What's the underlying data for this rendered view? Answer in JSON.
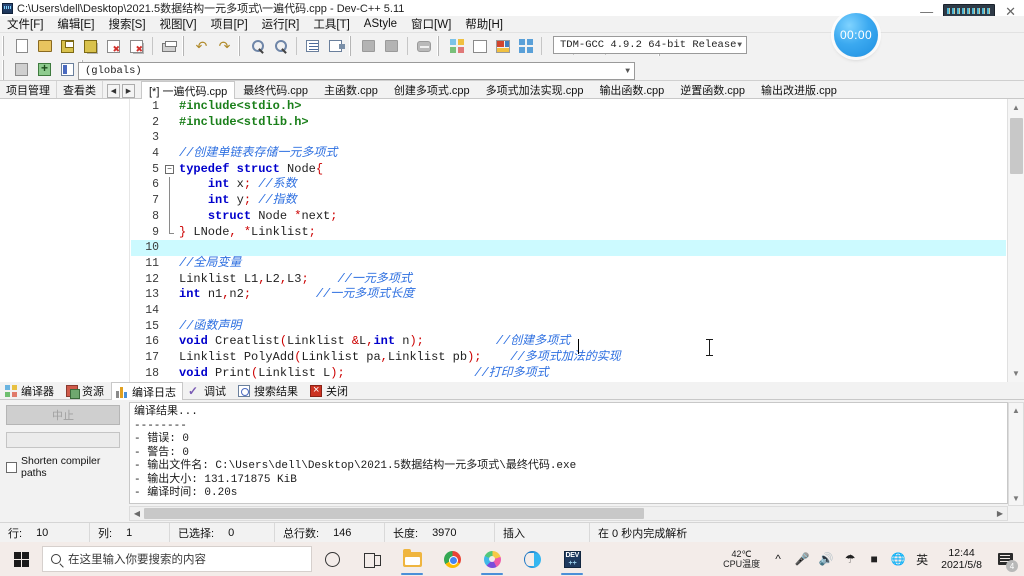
{
  "window": {
    "title": "C:\\Users\\dell\\Desktop\\2021.5数据结构一元多项式\\一遍代码.cpp - Dev-C++ 5.11",
    "minimize_label": "—",
    "close_label": "✕"
  },
  "timer": {
    "value": "00:00"
  },
  "menu": {
    "items": [
      {
        "label": "文件[F]"
      },
      {
        "label": "编辑[E]"
      },
      {
        "label": "搜索[S]"
      },
      {
        "label": "视图[V]"
      },
      {
        "label": "项目[P]"
      },
      {
        "label": "运行[R]"
      },
      {
        "label": "工具[T]"
      },
      {
        "label": "AStyle"
      },
      {
        "label": "窗口[W]"
      },
      {
        "label": "帮助[H]"
      }
    ]
  },
  "toolbar": {
    "compiler_combo": {
      "value": "TDM-GCC 4.9.2 64-bit Release",
      "arrow": "▼"
    },
    "globals_combo": {
      "value": "(globals)",
      "arrow": "▼"
    },
    "buttons": [
      {
        "name": "new-file",
        "icon": "page-icon"
      },
      {
        "name": "open-file",
        "icon": "folder-open-icon"
      },
      {
        "name": "save-file",
        "icon": "save-icon"
      },
      {
        "name": "save-all",
        "icon": "save-all-icon"
      },
      {
        "name": "close-file",
        "icon": "close-file-icon"
      },
      {
        "name": "close-all",
        "icon": "close-all-icon"
      },
      {
        "name": "print",
        "icon": "printer-icon"
      },
      {
        "name": "undo",
        "icon": "undo-icon"
      },
      {
        "name": "redo",
        "icon": "redo-icon"
      },
      {
        "name": "find",
        "icon": "find-icon"
      },
      {
        "name": "replace",
        "icon": "replace-icon"
      },
      {
        "name": "goto-line",
        "icon": "goto-line-icon"
      },
      {
        "name": "toggle-bookmark",
        "icon": "bookmark-icon"
      },
      {
        "name": "compile",
        "icon": "compile-icon"
      },
      {
        "name": "run",
        "icon": "run-icon"
      },
      {
        "name": "compile-and-run",
        "icon": "compile-run-icon"
      },
      {
        "name": "rebuild-all",
        "icon": "rebuild-icon"
      },
      {
        "name": "syntax-check",
        "icon": "check-icon"
      },
      {
        "name": "stop-execution",
        "icon": "stop-icon"
      },
      {
        "name": "profile",
        "icon": "profile-icon"
      },
      {
        "name": "debug",
        "icon": "debug-bug-icon"
      }
    ]
  },
  "left_panel": {
    "tabs": [
      {
        "label": "项目管理"
      },
      {
        "label": "查看类"
      }
    ],
    "nav": {
      "prev": "◀",
      "next": "▶"
    }
  },
  "editor_tabs": [
    {
      "label": "[*] 一遍代码.cpp",
      "active": true
    },
    {
      "label": "最终代码.cpp",
      "active": false
    },
    {
      "label": "主函数.cpp",
      "active": false
    },
    {
      "label": "创建多项式.cpp",
      "active": false
    },
    {
      "label": "多项式加法实现.cpp",
      "active": false
    },
    {
      "label": "输出函数.cpp",
      "active": false
    },
    {
      "label": "逆置函数.cpp",
      "active": false
    },
    {
      "label": "输出改进版.cpp",
      "active": false
    }
  ],
  "code": {
    "lines": [
      {
        "n": "1",
        "fold": "",
        "current": false,
        "html": "<span class=\"pp\">#include&lt;stdio.h&gt;</span>"
      },
      {
        "n": "2",
        "fold": "",
        "current": false,
        "html": "<span class=\"pp\">#include&lt;stdlib.h&gt;</span>"
      },
      {
        "n": "3",
        "fold": "",
        "current": false,
        "html": ""
      },
      {
        "n": "4",
        "fold": "",
        "current": false,
        "html": "<span class=\"cm\">//创建单链表存储一元多项式</span>"
      },
      {
        "n": "5",
        "fold": "open",
        "current": false,
        "html": "<span class=\"k\">typedef</span> <span class=\"k\">struct</span> <span class=\"id\">Node</span><span class=\"sy\">{</span>"
      },
      {
        "n": "6",
        "fold": "bar",
        "current": false,
        "html": "    <span class=\"k\">int</span> <span class=\"id\">x</span><span class=\"sy\">;</span> <span class=\"cm\">//系数</span>"
      },
      {
        "n": "7",
        "fold": "bar",
        "current": false,
        "html": "    <span class=\"k\">int</span> <span class=\"id\">y</span><span class=\"sy\">;</span> <span class=\"cm\">//指数</span>"
      },
      {
        "n": "8",
        "fold": "bar",
        "current": false,
        "html": "    <span class=\"k\">struct</span> <span class=\"id\">Node</span> <span class=\"sy\">*</span><span class=\"id\">next</span><span class=\"sy\">;</span>"
      },
      {
        "n": "9",
        "fold": "close",
        "current": false,
        "html": "<span class=\"sy\">}</span> <span class=\"id\">LNode</span><span class=\"sy\">,</span> <span class=\"sy\">*</span><span class=\"id\">Linklist</span><span class=\"sy\">;</span>"
      },
      {
        "n": "10",
        "fold": "",
        "current": true,
        "html": ""
      },
      {
        "n": "11",
        "fold": "",
        "current": false,
        "html": "<span class=\"cm\">//全局变量</span>"
      },
      {
        "n": "12",
        "fold": "",
        "current": false,
        "html": "<span class=\"id\">Linklist</span> <span class=\"id\">L1</span><span class=\"sy\">,</span><span class=\"id\">L2</span><span class=\"sy\">,</span><span class=\"id\">L3</span><span class=\"sy\">;</span>    <span class=\"cm\">//一元多项式</span>"
      },
      {
        "n": "13",
        "fold": "",
        "current": false,
        "html": "<span class=\"k\">int</span> <span class=\"id\">n1</span><span class=\"sy\">,</span><span class=\"id\">n2</span><span class=\"sy\">;</span>         <span class=\"cm\">//一元多项式长度</span>"
      },
      {
        "n": "14",
        "fold": "",
        "current": false,
        "html": ""
      },
      {
        "n": "15",
        "fold": "",
        "current": false,
        "html": "<span class=\"cm\">//函数声明</span>"
      },
      {
        "n": "16",
        "fold": "",
        "current": false,
        "html": "<span class=\"k\">void</span> <span class=\"id\">Creatlist</span><span class=\"sy\">(</span><span class=\"id\">Linklist</span> <span class=\"sy\">&amp;</span><span class=\"id\">L</span><span class=\"sy\">,</span><span class=\"k\">int</span> <span class=\"id\">n</span><span class=\"sy\">);</span>          <span class=\"cm\">//创建多项式</span>"
      },
      {
        "n": "17",
        "fold": "",
        "current": false,
        "html": "<span class=\"id\">Linklist</span> <span class=\"id\">PolyAdd</span><span class=\"sy\">(</span><span class=\"id\">Linklist</span> <span class=\"id\">pa</span><span class=\"sy\">,</span><span class=\"id\">Linklist</span> <span class=\"id\">pb</span><span class=\"sy\">);</span>    <span class=\"cm\">//多项式加法的实现</span>"
      },
      {
        "n": "18",
        "fold": "",
        "current": false,
        "html": "<span class=\"k\">void</span> <span class=\"id\">Print</span><span class=\"sy\">(</span><span class=\"id\">Linklist</span> <span class=\"id\">L</span><span class=\"sy\">);</span>                  <span class=\"cm\">//打印多项式</span>"
      }
    ]
  },
  "bottom_panel": {
    "tabs": [
      {
        "label": "编译器",
        "icon": "compiler-icon",
        "active": false
      },
      {
        "label": "资源",
        "icon": "resources-icon",
        "active": false
      },
      {
        "label": "编译日志",
        "icon": "compile-log-icon",
        "active": true
      },
      {
        "label": "调试",
        "icon": "debug-icon",
        "active": false
      },
      {
        "label": "搜索结果",
        "icon": "search-results-icon",
        "active": false
      },
      {
        "label": "关闭",
        "icon": "close-panel-icon",
        "active": false
      }
    ],
    "abort_button": "中止",
    "shorten_checkbox": "Shorten compiler paths",
    "log_lines": [
      "编译结果...",
      "--------",
      "- 错误: 0",
      "- 警告: 0",
      "- 输出文件名: C:\\Users\\dell\\Desktop\\2021.5数据结构一元多项式\\最终代码.exe",
      "- 输出大小: 131.171875 KiB",
      "- 编译时间: 0.20s"
    ]
  },
  "statusbar": {
    "cells": [
      {
        "label": "行:",
        "value": "10"
      },
      {
        "label": "列:",
        "value": "1"
      },
      {
        "label": "已选择:",
        "value": "0"
      },
      {
        "label": "总行数:",
        "value": "146"
      },
      {
        "label": "长度:",
        "value": "3970"
      },
      {
        "label": "",
        "value": "插入"
      },
      {
        "label": "",
        "value": "在 0 秒内完成解析"
      }
    ]
  },
  "taskbar": {
    "search_placeholder": "在这里输入你要搜索的内容",
    "apps": [
      {
        "name": "cortana-icon"
      },
      {
        "name": "task-view-icon"
      },
      {
        "name": "file-explorer-icon"
      },
      {
        "name": "chrome-icon"
      },
      {
        "name": "photos-icon"
      },
      {
        "name": "edge-icon"
      },
      {
        "name": "devcpp-icon"
      }
    ],
    "cpu_temp_value": "42℃",
    "cpu_temp_label": "CPU温度",
    "tray_icons": [
      "chevron-up-icon",
      "microphone-icon",
      "volume-icon",
      "security-icon",
      "battery-icon",
      "network-icon"
    ],
    "ime_label": "英",
    "clock_time": "12:44",
    "clock_date": "2021/5/8",
    "notification_count": "4"
  }
}
